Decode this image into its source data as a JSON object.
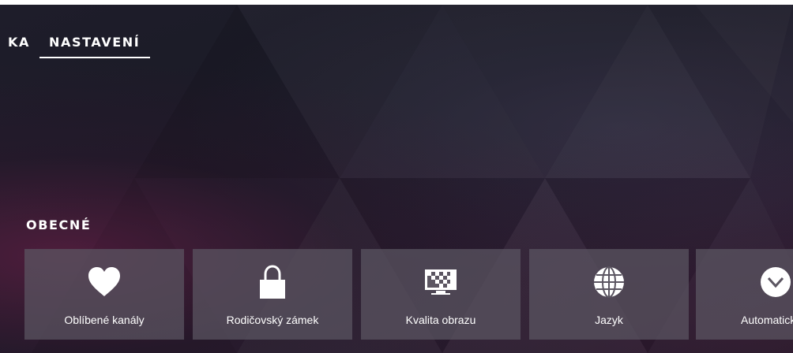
{
  "nav": {
    "items": [
      {
        "label": "KA",
        "active": false
      },
      {
        "label": "NASTAVENÍ",
        "active": true
      }
    ]
  },
  "section": {
    "title": "OBECNÉ"
  },
  "tiles": [
    {
      "label": "Oblíbené kanály",
      "icon": "heart-icon"
    },
    {
      "label": "Rodičovský zámek",
      "icon": "lock-icon"
    },
    {
      "label": "Kvalita obrazu",
      "icon": "tv-quality-icon"
    },
    {
      "label": "Jazyk",
      "icon": "globe-icon"
    },
    {
      "label": "Automatické v",
      "icon": "chevron-down-circle-icon"
    }
  ],
  "colors": {
    "background": "#1c1b27",
    "tile": "#5c5662",
    "text": "#ffffff"
  }
}
